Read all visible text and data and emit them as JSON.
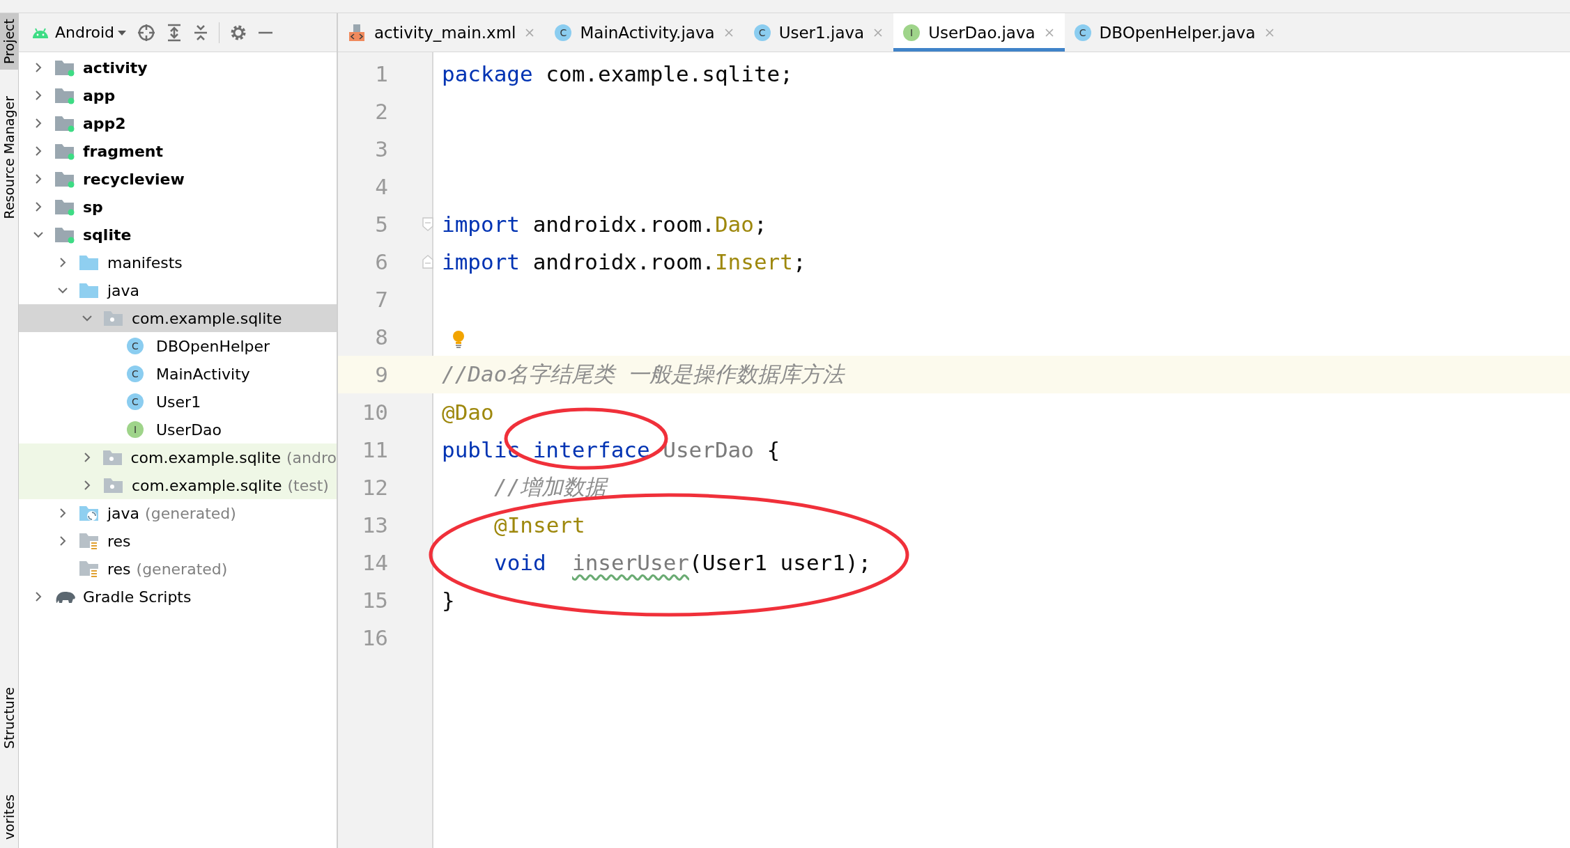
{
  "side_strip": {
    "top": [
      {
        "label": "Project",
        "selected": true
      },
      {
        "label": "Resource Manager",
        "selected": false
      }
    ],
    "bottom": [
      {
        "label": "Structure",
        "selected": false
      },
      {
        "label": "vorites",
        "selected": false
      }
    ]
  },
  "project_toolbar": {
    "view": "Android"
  },
  "tree": [
    {
      "name": "activity",
      "kind": "module",
      "bold": true,
      "expanded": false
    },
    {
      "name": "app",
      "kind": "module",
      "bold": true,
      "expanded": false
    },
    {
      "name": "app2",
      "kind": "module",
      "bold": true,
      "expanded": false
    },
    {
      "name": "fragment",
      "kind": "module",
      "bold": true,
      "expanded": false
    },
    {
      "name": "recycleview",
      "kind": "module",
      "bold": true,
      "expanded": false
    },
    {
      "name": "sp",
      "kind": "module",
      "bold": true,
      "expanded": false
    },
    {
      "name": "sqlite",
      "kind": "module",
      "bold": true,
      "expanded": true,
      "children": [
        {
          "name": "manifests",
          "kind": "folder",
          "expanded": false
        },
        {
          "name": "java",
          "kind": "folder",
          "expanded": true,
          "children": [
            {
              "name": "com.example.sqlite",
              "kind": "package",
              "expanded": true,
              "selected": true,
              "children": [
                {
                  "name": "DBOpenHelper",
                  "kind": "class",
                  "letter": "C"
                },
                {
                  "name": "MainActivity",
                  "kind": "class",
                  "letter": "C"
                },
                {
                  "name": "User1",
                  "kind": "class",
                  "letter": "C"
                },
                {
                  "name": "UserDao",
                  "kind": "interface",
                  "letter": "I"
                }
              ]
            },
            {
              "name": "com.example.sqlite",
              "suffix": "(andro",
              "kind": "package",
              "expanded": false,
              "test_source": true
            },
            {
              "name": "com.example.sqlite",
              "suffix": "(test)",
              "kind": "package",
              "expanded": false,
              "test_source": true
            }
          ]
        },
        {
          "name": "java",
          "suffix": "(generated)",
          "kind": "generated",
          "expanded": false
        },
        {
          "name": "res",
          "kind": "res",
          "expanded": false
        },
        {
          "name": "res",
          "suffix": "(generated)",
          "kind": "res"
        }
      ]
    },
    {
      "name": "Gradle Scripts",
      "kind": "gradle",
      "expanded": false
    }
  ],
  "tabs": [
    {
      "label": "activity_main.xml",
      "kind": "xml",
      "selected": false
    },
    {
      "label": "MainActivity.java",
      "kind": "class",
      "letter": "C",
      "selected": false
    },
    {
      "label": "User1.java",
      "kind": "class",
      "letter": "C",
      "selected": false
    },
    {
      "label": "UserDao.java",
      "kind": "interface",
      "letter": "I",
      "selected": true
    },
    {
      "label": "DBOpenHelper.java",
      "kind": "class",
      "letter": "C",
      "selected": false
    }
  ],
  "editor": {
    "lines": [
      {
        "number": "1",
        "current": false,
        "tokens": [
          {
            "text": "package",
            "kind": "keyword"
          },
          {
            "text": " com.example.sqlite;",
            "kind": "plain"
          }
        ]
      },
      {
        "number": "2",
        "current": false
      },
      {
        "number": "3",
        "current": false
      },
      {
        "number": "4",
        "current": false
      },
      {
        "number": "5",
        "current": false,
        "fold_start": true,
        "tokens": [
          {
            "text": "import",
            "kind": "keyword"
          },
          {
            "text": " androidx.room.",
            "kind": "plain"
          },
          {
            "text": "Dao",
            "kind": "annotation"
          },
          {
            "text": ";",
            "kind": "plain"
          }
        ]
      },
      {
        "number": "6",
        "current": false,
        "fold_end": true,
        "tokens": [
          {
            "text": "import",
            "kind": "keyword"
          },
          {
            "text": " androidx.room.",
            "kind": "plain"
          },
          {
            "text": "Insert",
            "kind": "annotation"
          },
          {
            "text": ";",
            "kind": "plain"
          }
        ]
      },
      {
        "number": "7",
        "current": false
      },
      {
        "number": "8",
        "current": false,
        "bulb": true
      },
      {
        "number": "9",
        "current": true,
        "tokens": [
          {
            "text": "//Dao名字结尾类 一般是操作数据库方法",
            "kind": "comment"
          }
        ]
      },
      {
        "number": "10",
        "current": false,
        "tokens": [
          {
            "text": "@Dao",
            "kind": "annotation"
          }
        ]
      },
      {
        "number": "11",
        "current": false,
        "tokens": [
          {
            "text": "public interface ",
            "kind": "keyword"
          },
          {
            "text": "UserDao",
            "kind": "unused"
          },
          {
            "text": " {",
            "kind": "plain"
          }
        ]
      },
      {
        "number": "12",
        "current": false,
        "indented": true,
        "tokens": [
          {
            "text": "//增加数据",
            "kind": "comment"
          }
        ]
      },
      {
        "number": "13",
        "current": false,
        "indented": true,
        "tokens": [
          {
            "text": "@Insert",
            "kind": "annotation"
          }
        ]
      },
      {
        "number": "14",
        "current": false,
        "indented": true,
        "tokens": [
          {
            "text": "void  ",
            "kind": "keyword"
          },
          {
            "text": "inserUser",
            "kind": "typo"
          },
          {
            "text": "(User1 user1);",
            "kind": "plain"
          }
        ]
      },
      {
        "number": "15",
        "current": false,
        "tokens": [
          {
            "text": "}",
            "kind": "plain"
          }
        ]
      },
      {
        "number": "16",
        "current": false
      }
    ]
  }
}
